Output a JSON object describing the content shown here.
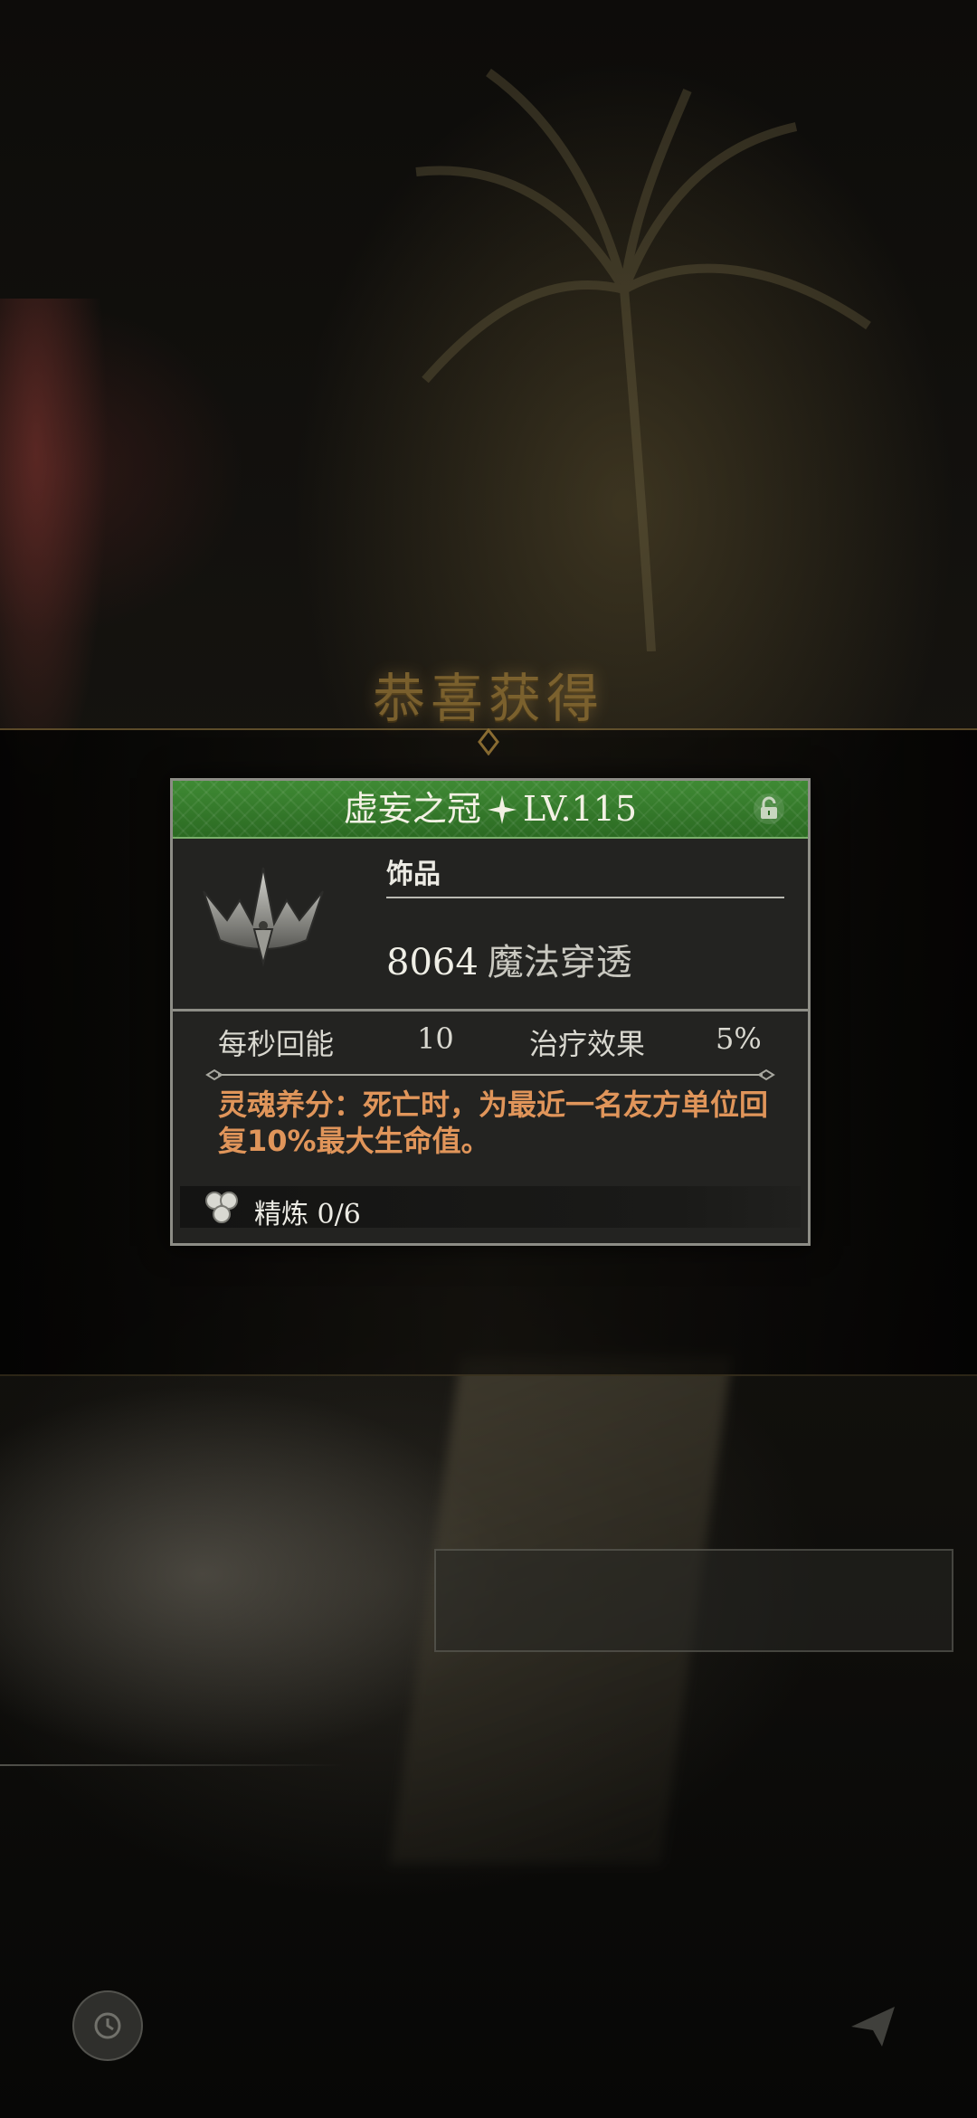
{
  "banner": {
    "title": "恭喜获得"
  },
  "item": {
    "name": "虚妄之冠",
    "level": "LV.115",
    "category": "饰品",
    "main_stat": {
      "value": "8064",
      "label": "魔法穿透"
    },
    "stats": [
      {
        "label": "每秒回能",
        "value": "10"
      },
      {
        "label": "治疗效果",
        "value": "5%"
      }
    ],
    "description": "灵魂养分：死亡时，为最近一名友方单位回复10%最大生命值。",
    "refine": {
      "label": "精炼",
      "value": "0/6"
    }
  },
  "colors": {
    "header_green": "#3f8a34",
    "description_orange": "#e0955a",
    "card_border": "#8d8d86"
  }
}
